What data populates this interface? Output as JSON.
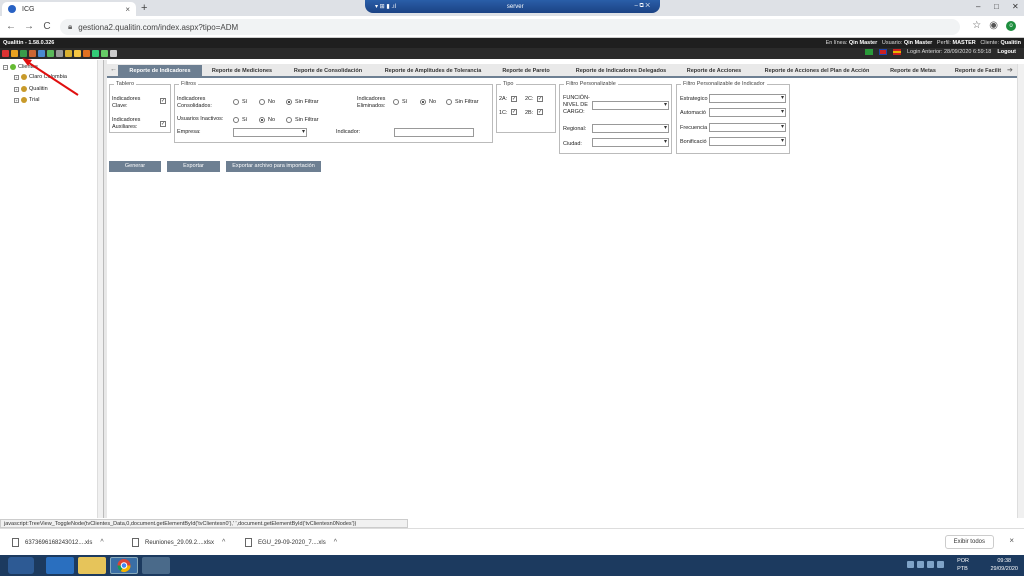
{
  "browser": {
    "tab_title": "ICG",
    "tab_close": "×",
    "new_tab": "+",
    "rdp_title": "server",
    "url": "gestiona2.qualitin.com/index.aspx?tipo=ADM",
    "back": "←",
    "forward": "→",
    "reload": "C"
  },
  "app": {
    "version": "Qualitin - 1.58.0.326",
    "online_label": "En línea:",
    "online_user": "Qin Master",
    "user_label": "Usuario:",
    "user": "Qin Master",
    "profile_label": "Perfil:",
    "profile": "MASTER",
    "client_label": "Cliente:",
    "client": "Qualitin",
    "last_login": "Login Anterior: 28/09/2020 6:59:18",
    "logout": "Logout"
  },
  "tree": {
    "root": "Clientes",
    "items": [
      "Claro Colombia",
      "Qualitin",
      "Trial"
    ]
  },
  "tabs": [
    "Reporte de Indicadores",
    "Reporte de Mediciones",
    "Reporte de Consolidación",
    "Reporte de Amplitudes de Tolerancia",
    "Reporte de Pareto",
    "Reporte de Indicadores Delegados",
    "Reporte de Acciones",
    "Reporte de Acciones del Plan de Acción",
    "Reporte de Metas",
    "Reporte de Facilit"
  ],
  "tablero": {
    "legend": "Tablero",
    "clave": "Indicadores Clave:",
    "auxiliares": "Indicadores Auxiliares:",
    "check": "✓"
  },
  "filtros": {
    "legend": "Filtros",
    "consolidados": "Indicadores Consolidados:",
    "eliminados": "Indicadores Eliminados:",
    "inactivos": "Usuarios Inactivos:",
    "empresa": "Empresa:",
    "indicador": "Indicador:",
    "si": "Sí",
    "no": "No",
    "sin_filtrar": "Sin Filtrar"
  },
  "tipo": {
    "legend": "Tipo",
    "items": [
      "2A:",
      "2C:",
      "1C:",
      "2B:"
    ]
  },
  "personalizable": {
    "legend": "Filtro Personalizable",
    "funcion": "FUNCIÓN-NIVEL DE CARGO:",
    "regional": "Regional:",
    "ciudad": "Ciudad:"
  },
  "personalizable_ind": {
    "legend": "Filtro Personalizable de Indicador",
    "items": [
      "Estrategico",
      "Automació",
      "Frecuencia",
      "Bonificació"
    ]
  },
  "buttons": {
    "generar": "Generar",
    "exportar": "Exportar",
    "exportar_archivo": "Exportar archivo para importación"
  },
  "status_url": "javascript:TreeView_ToggleNode(tvClientes_Data,0,document.getElementById('tvClientesn0'),' ',document.getElementById('tvClientesn0Nodes'))",
  "downloads": {
    "items": [
      "637369616824301​2....xls",
      "Reuniones_29.09.2....xlsx",
      "EGU_29-09-2020_7....xls"
    ],
    "show_all": "Exibir todos",
    "close": "×",
    "chevron": "^"
  },
  "taskbar": {
    "lang1": "POR",
    "lang2": "PTB",
    "time": "09:38",
    "date": "29/09/2020"
  }
}
